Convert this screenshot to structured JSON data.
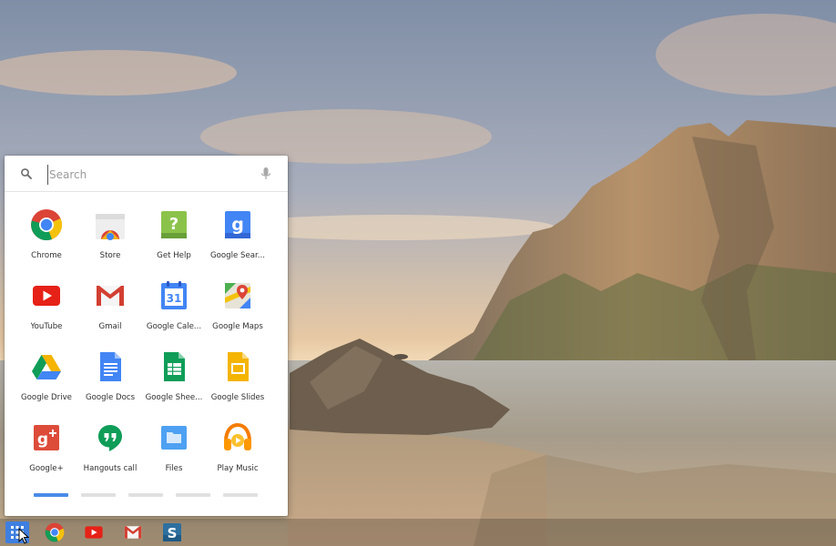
{
  "launcher": {
    "search": {
      "placeholder": "Search"
    },
    "apps": [
      {
        "label": "Chrome",
        "icon": "chrome-icon"
      },
      {
        "label": "Store",
        "icon": "web-store-icon"
      },
      {
        "label": "Get Help",
        "icon": "get-help-icon"
      },
      {
        "label": "Google Sear...",
        "icon": "google-search-icon"
      },
      {
        "label": "YouTube",
        "icon": "youtube-icon"
      },
      {
        "label": "Gmail",
        "icon": "gmail-icon"
      },
      {
        "label": "Google Cale...",
        "icon": "google-calendar-icon"
      },
      {
        "label": "Google Maps",
        "icon": "google-maps-icon"
      },
      {
        "label": "Google Drive",
        "icon": "google-drive-icon"
      },
      {
        "label": "Google Docs",
        "icon": "google-docs-icon"
      },
      {
        "label": "Google Shee...",
        "icon": "google-sheets-icon"
      },
      {
        "label": "Google Slides",
        "icon": "google-slides-icon"
      },
      {
        "label": "Google+",
        "icon": "google-plus-icon"
      },
      {
        "label": "Hangouts call",
        "icon": "hangouts-icon"
      },
      {
        "label": "Files",
        "icon": "files-icon"
      },
      {
        "label": "Play Music",
        "icon": "play-music-icon"
      }
    ],
    "calendar_day": "31",
    "pages": {
      "count": 5,
      "active": 0
    }
  },
  "shelf": {
    "items": [
      {
        "name": "app-launcher",
        "icon": "app-launcher-icon"
      },
      {
        "name": "chrome",
        "icon": "chrome-icon"
      },
      {
        "name": "youtube",
        "icon": "youtube-icon"
      },
      {
        "name": "gmail",
        "icon": "gmail-icon"
      },
      {
        "name": "s-app",
        "icon": "s-app-icon",
        "letter": "S"
      }
    ]
  },
  "colors": {
    "google_blue": "#4285f4",
    "google_red": "#db4437",
    "google_yellow": "#f4b400",
    "google_green": "#0f9d58",
    "active_page": "#4a8ae8"
  }
}
